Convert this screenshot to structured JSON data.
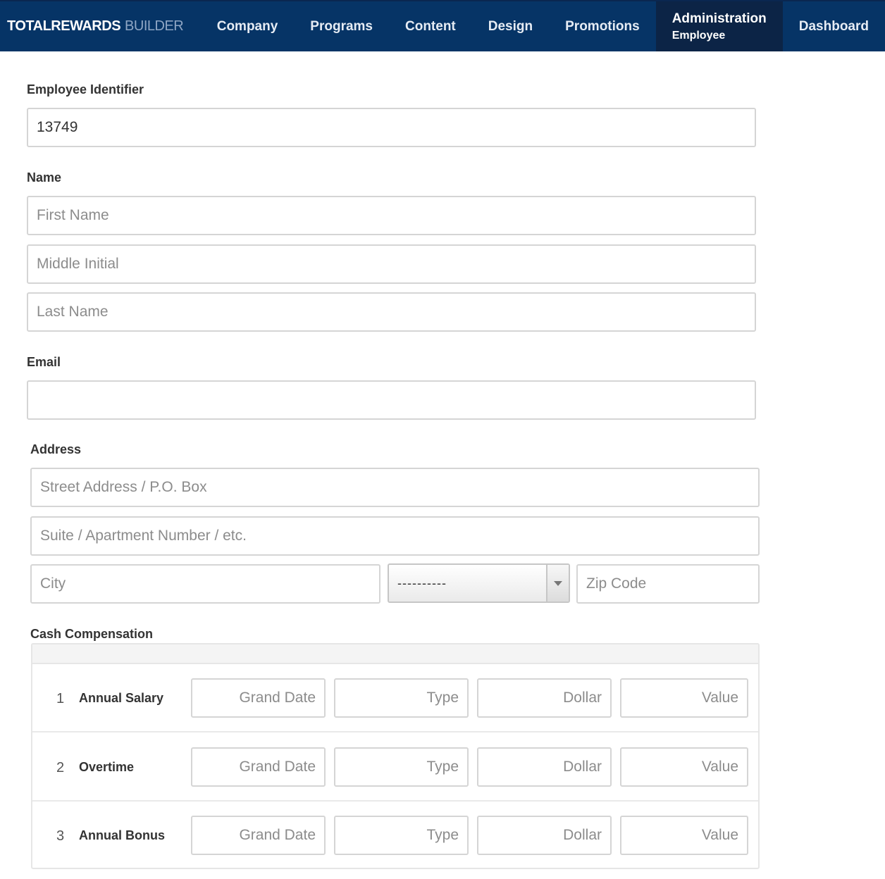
{
  "navbar": {
    "brand_main": "TOTALREWARDS",
    "brand_sub": "BUILDER",
    "items": [
      {
        "label": "Company"
      },
      {
        "label": "Programs"
      },
      {
        "label": "Content"
      },
      {
        "label": "Design"
      },
      {
        "label": "Promotions"
      },
      {
        "label": "Administration",
        "sub": "Employee",
        "active": true
      },
      {
        "label": "Dashboard"
      }
    ]
  },
  "form": {
    "employee_identifier": {
      "label": "Employee Identifier",
      "value": "13749"
    },
    "name": {
      "label": "Name",
      "first_placeholder": "First Name",
      "middle_placeholder": "Middle Initial",
      "last_placeholder": "Last Name"
    },
    "email": {
      "label": "Email",
      "value": ""
    },
    "address": {
      "label": "Address",
      "street_placeholder": "Street Address / P.O. Box",
      "suite_placeholder": "Suite / Apartment Number / etc.",
      "city_placeholder": "City",
      "state_selected": "----------",
      "zip_placeholder": "Zip Code"
    },
    "cash_compensation": {
      "label": "Cash Compensation",
      "field_placeholders": {
        "grand_date": "Grand Date",
        "type": "Type",
        "dollar": "Dollar",
        "value": "Value"
      },
      "rows": [
        {
          "num": "1",
          "label": "Annual Salary"
        },
        {
          "num": "2",
          "label": "Overtime"
        },
        {
          "num": "3",
          "label": "Annual Bonus"
        }
      ]
    }
  },
  "colors": {
    "navbar": "#063466",
    "navbar_active": "#0c2446",
    "border": "#d5d5d5"
  }
}
